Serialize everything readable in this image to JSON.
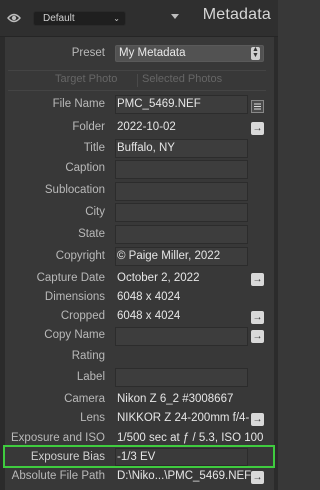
{
  "header": {
    "preset_dropdown": "Default",
    "panel_title": "Metadata"
  },
  "preset": {
    "label": "Preset",
    "value": "My Metadata"
  },
  "tabs": [
    "Target Photo",
    "Selected Photos"
  ],
  "fields": [
    {
      "label": "File Name",
      "value": "PMC_5469.NEF"
    },
    {
      "label": "Folder",
      "value": "2022-10-02"
    },
    {
      "label": "Title",
      "value": "Buffalo, NY"
    },
    {
      "label": "Caption",
      "value": ""
    },
    {
      "label": "Sublocation",
      "value": ""
    },
    {
      "label": "City",
      "value": ""
    },
    {
      "label": "State",
      "value": ""
    },
    {
      "label": "Copyright",
      "value": "© Paige Miller, 2022"
    },
    {
      "label": "Capture Date",
      "value": "October 2, 2022"
    },
    {
      "label": "Dimensions",
      "value": "6048 x 4024"
    },
    {
      "label": "Cropped",
      "value": "6048 x 4024"
    },
    {
      "label": "Copy Name",
      "value": ""
    },
    {
      "label": "Rating",
      "value": ""
    },
    {
      "label": "Label",
      "value": ""
    },
    {
      "label": "Camera",
      "value": "Nikon Z 6_2 #3008667"
    },
    {
      "label": "Lens",
      "value": "NIKKOR Z 24-200mm f/4-"
    },
    {
      "label": "Exposure and ISO",
      "value": "1/500 sec at ƒ / 5.3, ISO 100"
    },
    {
      "label": "Exposure Bias",
      "value": "-1/3 EV"
    },
    {
      "label": "Absolute File Path",
      "value": "D:\\Niko...\\PMC_5469.NEF"
    }
  ],
  "icons": {
    "visibility": "eye-icon",
    "dropdown_arrow": "chevron-down-icon",
    "select_arrows": "updown-arrows-icon",
    "action": "arrow-right-icon",
    "file_name_action": "document-list-icon"
  },
  "colors": {
    "highlight": "#3fcc3f",
    "panel_bg": "#383838"
  }
}
